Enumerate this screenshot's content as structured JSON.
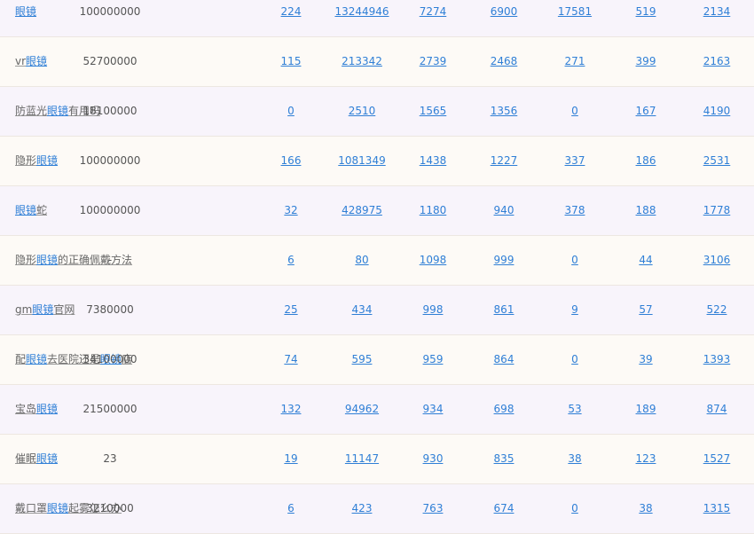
{
  "rows": [
    {
      "keyword_parts": [
        {
          "t": "眼镜",
          "h": true
        }
      ],
      "volume": "100000000",
      "metrics": [
        "224",
        "13244946",
        "7274",
        "6900",
        "17581",
        "519",
        "2134"
      ]
    },
    {
      "keyword_parts": [
        {
          "t": "vr",
          "h": false
        },
        {
          "t": "眼镜",
          "h": true
        }
      ],
      "volume": "52700000",
      "metrics": [
        "115",
        "213342",
        "2739",
        "2468",
        "271",
        "399",
        "2163"
      ]
    },
    {
      "keyword_parts": [
        {
          "t": "防蓝光",
          "h": false
        },
        {
          "t": "眼镜",
          "h": true
        },
        {
          "t": "有用吗",
          "h": false
        }
      ],
      "volume": "18100000",
      "metrics": [
        "0",
        "2510",
        "1565",
        "1356",
        "0",
        "167",
        "4190"
      ]
    },
    {
      "keyword_parts": [
        {
          "t": "隐形",
          "h": false
        },
        {
          "t": "眼镜",
          "h": true
        }
      ],
      "volume": "100000000",
      "metrics": [
        "166",
        "1081349",
        "1438",
        "1227",
        "337",
        "186",
        "2531"
      ]
    },
    {
      "keyword_parts": [
        {
          "t": "眼镜",
          "h": true
        },
        {
          "t": "蛇",
          "h": false
        }
      ],
      "volume": "100000000",
      "metrics": [
        "32",
        "428975",
        "1180",
        "940",
        "378",
        "188",
        "1778"
      ]
    },
    {
      "keyword_parts": [
        {
          "t": "隐形",
          "h": false
        },
        {
          "t": "眼镜",
          "h": true
        },
        {
          "t": "的正确佩戴方法",
          "h": false
        }
      ],
      "volume": "-",
      "metrics": [
        "6",
        "80",
        "1098",
        "999",
        "0",
        "44",
        "3106"
      ]
    },
    {
      "keyword_parts": [
        {
          "t": "gm",
          "h": false
        },
        {
          "t": "眼镜",
          "h": true
        },
        {
          "t": "官网",
          "h": false
        }
      ],
      "volume": "7380000",
      "metrics": [
        "25",
        "434",
        "998",
        "861",
        "9",
        "57",
        "522"
      ]
    },
    {
      "keyword_parts": [
        {
          "t": "配",
          "h": false
        },
        {
          "t": "眼镜",
          "h": true
        },
        {
          "t": "去医院还是",
          "h": false
        },
        {
          "t": "眼镜",
          "h": true
        },
        {
          "t": "店",
          "h": false
        }
      ],
      "volume": "34100000",
      "metrics": [
        "74",
        "595",
        "959",
        "864",
        "0",
        "39",
        "1393"
      ]
    },
    {
      "keyword_parts": [
        {
          "t": "宝岛",
          "h": false
        },
        {
          "t": "眼镜",
          "h": true
        }
      ],
      "volume": "21500000",
      "metrics": [
        "132",
        "94962",
        "934",
        "698",
        "53",
        "189",
        "874"
      ]
    },
    {
      "keyword_parts": [
        {
          "t": "催眠",
          "h": false
        },
        {
          "t": "眼镜",
          "h": true
        }
      ],
      "volume": "23",
      "metrics": [
        "19",
        "11147",
        "930",
        "835",
        "38",
        "123",
        "1527"
      ]
    },
    {
      "keyword_parts": [
        {
          "t": "戴口罩",
          "h": false
        },
        {
          "t": "眼镜",
          "h": true
        },
        {
          "t": "起雾怎么办",
          "h": false
        }
      ],
      "volume": "3210000",
      "metrics": [
        "6",
        "423",
        "763",
        "674",
        "0",
        "38",
        "1315"
      ]
    }
  ]
}
